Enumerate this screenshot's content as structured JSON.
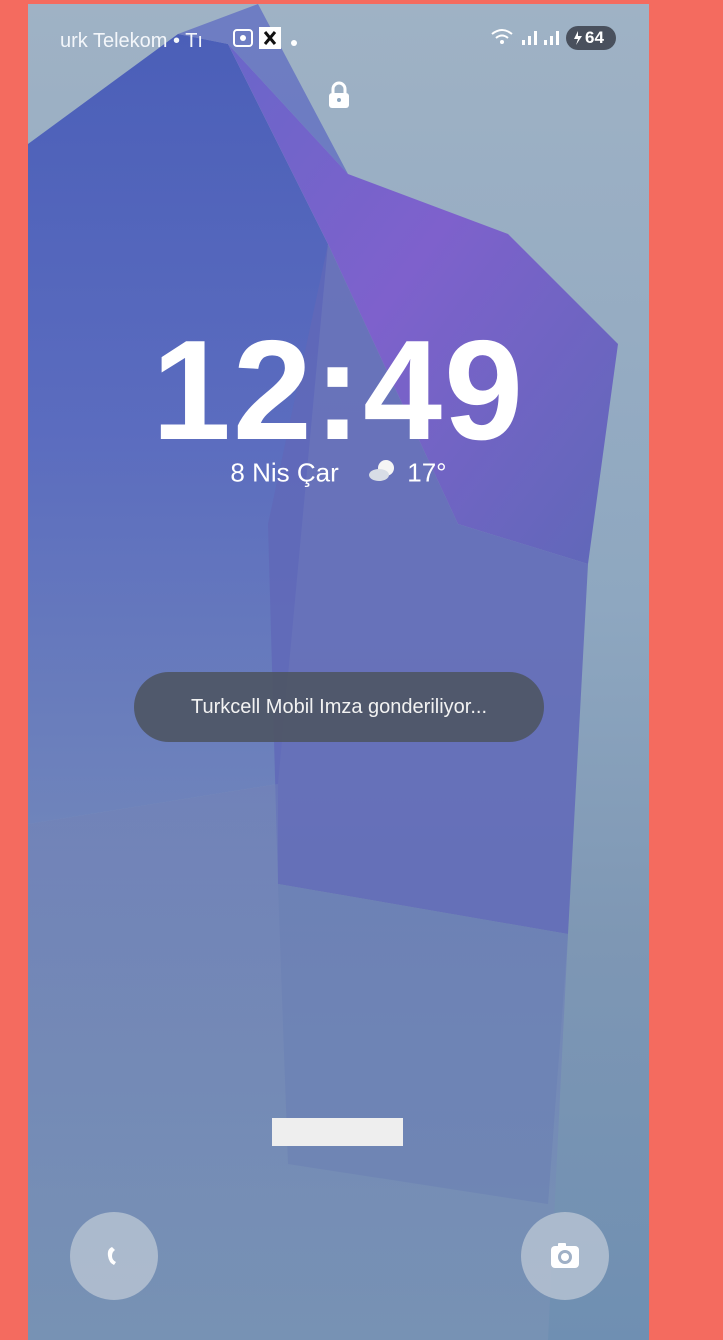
{
  "status_bar": {
    "carrier_text": "urk Telekom • Tı",
    "battery_level": "64"
  },
  "lockscreen": {
    "time": "12:49",
    "date": "8 Nis Çar",
    "temperature": "17°"
  },
  "toast": {
    "message": "Turkcell Mobil Imza gonderiliyor..."
  },
  "shortcuts": {
    "left": "phone-icon",
    "right": "camera-icon"
  },
  "colors": {
    "frame_background": "#f46b5f",
    "toast_background": "#4e5665",
    "text": "#ffffff"
  }
}
